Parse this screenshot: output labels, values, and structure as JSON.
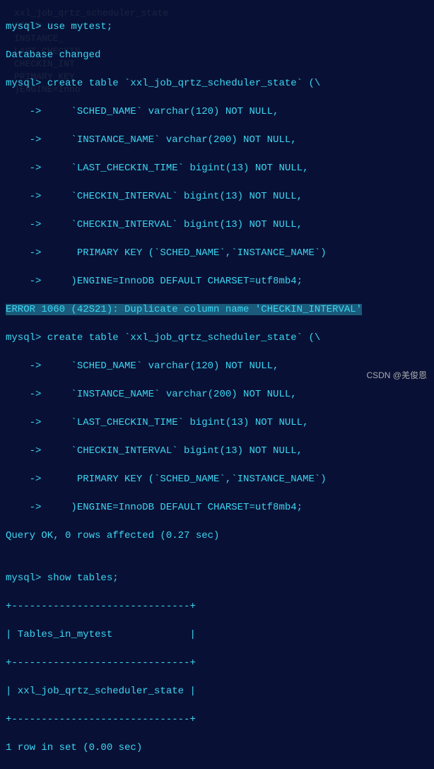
{
  "ghost": {
    "line1": "xxl_job_qrtz_scheduler_state ",
    "line2": "SCHED_N",
    "line3": "INSTANCE_",
    "line4": "LAST_CHECKIN_",
    "line5": "CHECKIN_INT",
    "line6": "PRIMARY KEY",
    "line7": ")ENGINE=Inno"
  },
  "terminal": {
    "lines": [
      "mysql> use mytest;",
      "Database changed",
      "mysql> create table `xxl_job_qrtz_scheduler_state` (\\",
      "    ->     `SCHED_NAME` varchar(120) NOT NULL,",
      "    ->     `INSTANCE_NAME` varchar(200) NOT NULL,",
      "    ->     `LAST_CHECKIN_TIME` bigint(13) NOT NULL,",
      "    ->     `CHECKIN_INTERVAL` bigint(13) NOT NULL,",
      "    ->     `CHECKIN_INTERVAL` bigint(13) NOT NULL,",
      "    ->      PRIMARY KEY (`SCHED_NAME`,`INSTANCE_NAME`)",
      "    ->     )ENGINE=InnoDB DEFAULT CHARSET=utf8mb4;"
    ],
    "error": "ERROR 1060 (42S21): Duplicate column name 'CHECKIN_INTERVAL'",
    "lines2": [
      "mysql> create table `xxl_job_qrtz_scheduler_state` (\\",
      "    ->     `SCHED_NAME` varchar(120) NOT NULL,",
      "    ->     `INSTANCE_NAME` varchar(200) NOT NULL,",
      "    ->     `LAST_CHECKIN_TIME` bigint(13) NOT NULL,",
      "    ->     `CHECKIN_INTERVAL` bigint(13) NOT NULL,",
      "    ->      PRIMARY KEY (`SCHED_NAME`,`INSTANCE_NAME`)",
      "    ->     )ENGINE=InnoDB DEFAULT CHARSET=utf8mb4;",
      "Query OK, 0 rows affected (0.27 sec)",
      "",
      "mysql> show tables;",
      "+------------------------------+",
      "| Tables_in_mytest             |",
      "+------------------------------+",
      "| xxl_job_qrtz_scheduler_state |",
      "+------------------------------+",
      "1 row in set (0.00 sec)"
    ]
  },
  "watermark": "CSDN @羌俊恩"
}
